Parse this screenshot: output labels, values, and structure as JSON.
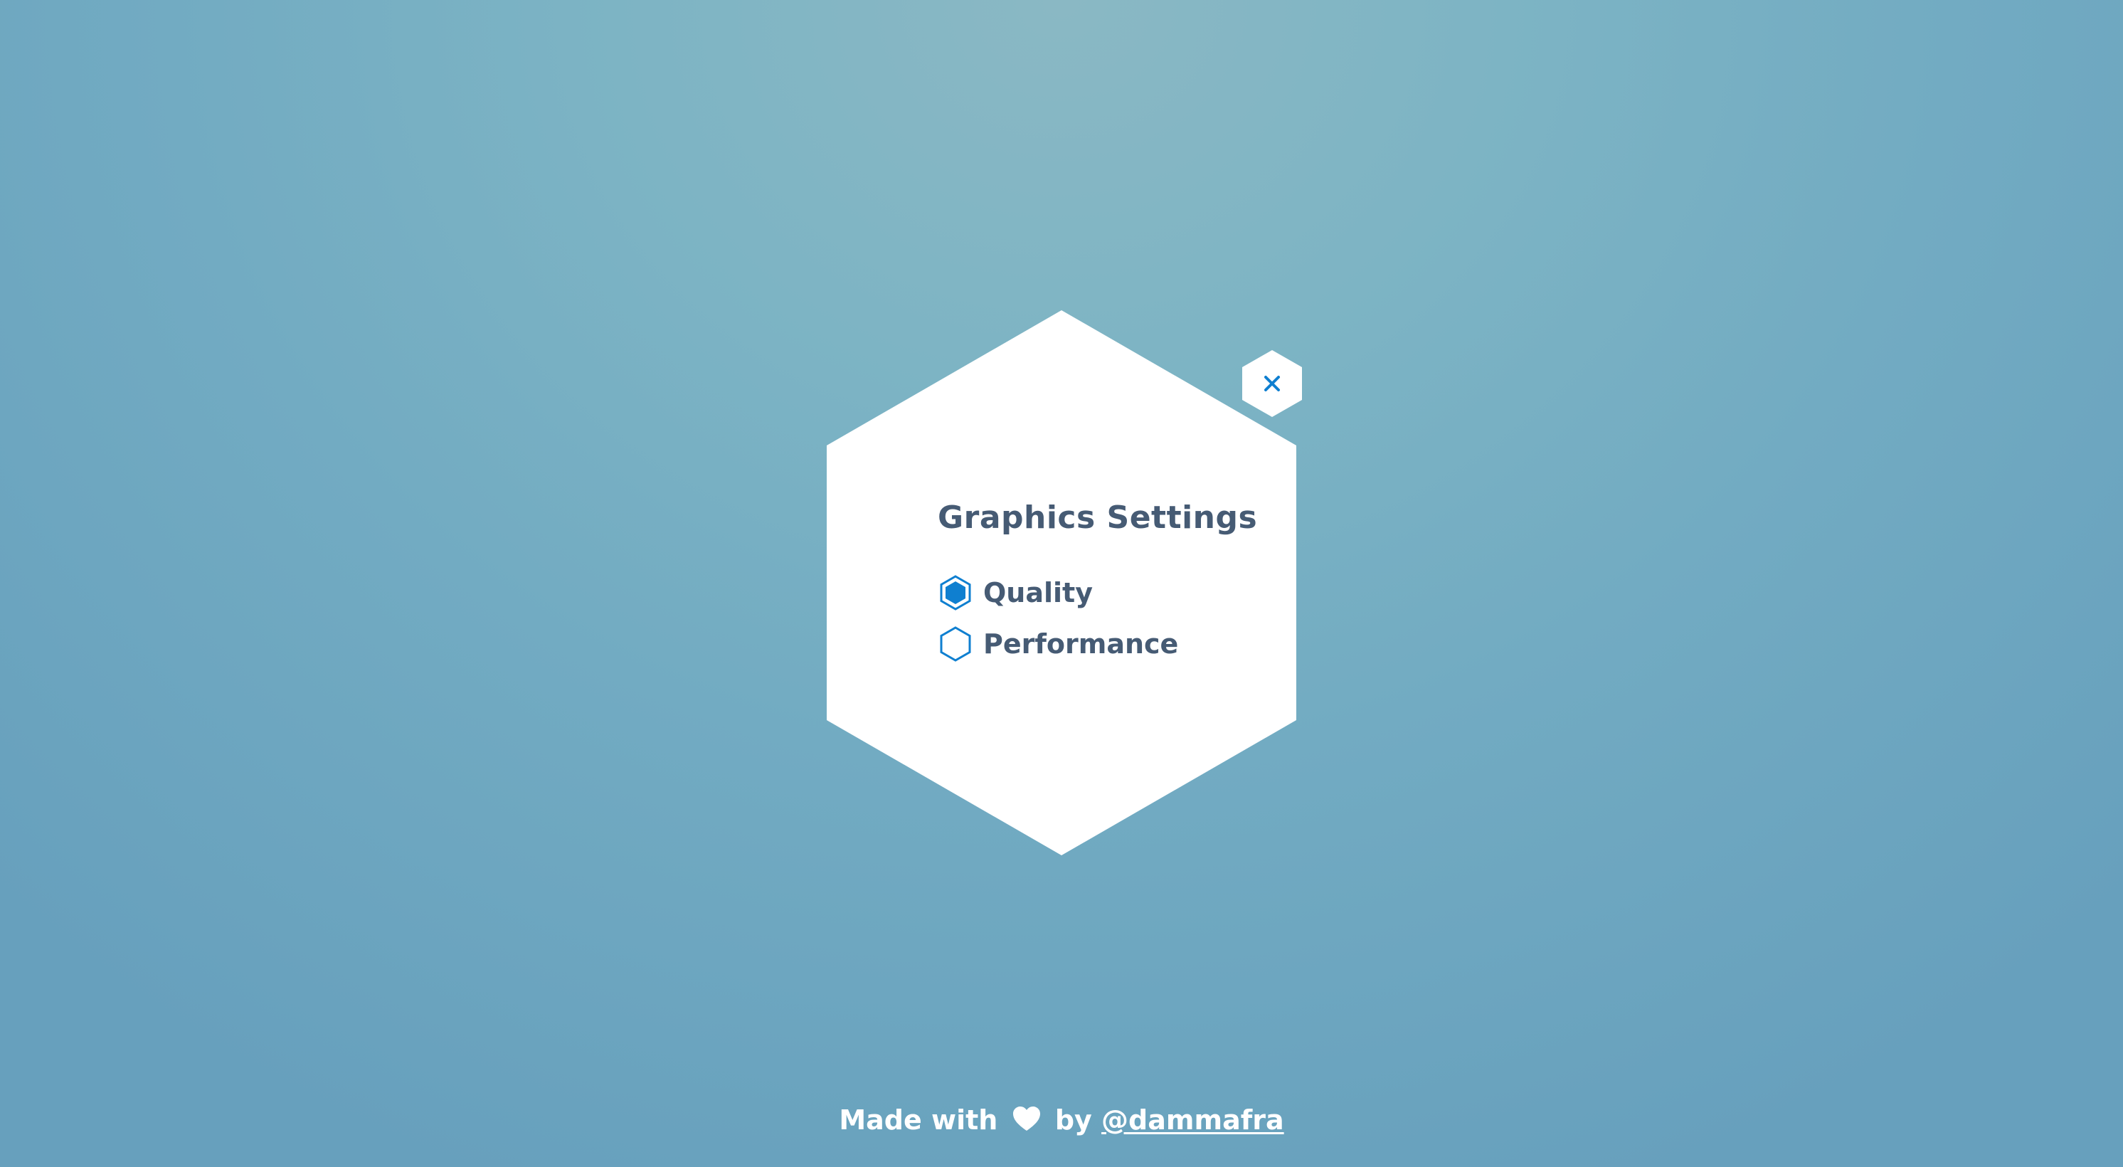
{
  "panel": {
    "title": "Graphics Settings",
    "options": [
      {
        "label": "Quality",
        "selected": true
      },
      {
        "label": "Performance",
        "selected": false
      }
    ],
    "close_icon": "close-icon"
  },
  "footer": {
    "made_with": "Made with",
    "heart_icon": "heart-icon",
    "by": "by",
    "author_link": "@dammafra"
  },
  "colors": {
    "background_top": "#8ab8c4",
    "background_bottom": "#67a0bd",
    "panel": "#ffffff",
    "text": "#465b74",
    "accent": "#0f7fd0"
  }
}
